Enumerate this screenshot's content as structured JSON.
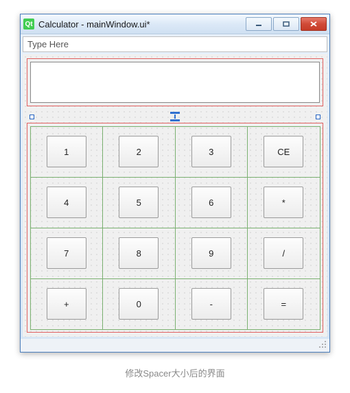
{
  "window": {
    "qt_icon": "Qt",
    "title": "Calculator - mainWindow.ui*"
  },
  "menubar": {
    "type_here": "Type Here"
  },
  "keypad": {
    "rows": [
      [
        "1",
        "2",
        "3",
        "CE"
      ],
      [
        "4",
        "5",
        "6",
        "*"
      ],
      [
        "7",
        "8",
        "9",
        "/"
      ],
      [
        "+",
        "0",
        "-",
        "="
      ]
    ]
  },
  "caption": "修改Spacer大小后的界面"
}
